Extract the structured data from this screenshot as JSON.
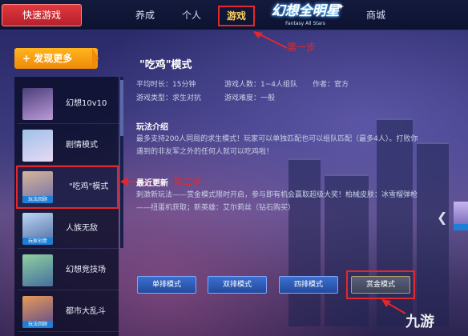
{
  "topbar": {
    "quick_game": "快速游戏",
    "nav": [
      "养成",
      "个人",
      "游戏",
      "商城"
    ],
    "active_nav": "游戏",
    "logo_main": "幻想全明星",
    "logo_sub": "Fantasy All Stars"
  },
  "annotations": {
    "step1": "第一步",
    "step2": "第二步"
  },
  "sidebar": {
    "discover_label": "+ 发现更多",
    "items": [
      {
        "label": "幻想10v10",
        "tag": ""
      },
      {
        "label": "剧情模式",
        "tag": ""
      },
      {
        "label": "\"吃鸡\"模式",
        "tag": "玩法回顾"
      },
      {
        "label": "人族无敌",
        "tag": "玩家创意"
      },
      {
        "label": "幻想竞技场",
        "tag": ""
      },
      {
        "label": "都市大乱斗",
        "tag": "玩法回顾"
      }
    ]
  },
  "panel": {
    "title": "\"吃鸡\"模式",
    "avg_time": "平均时长：15分钟",
    "players": "游戏人数：1~4人组队",
    "author": "作者：官方",
    "type": "游戏类型：求生对抗",
    "difficulty": "游戏难度：一般",
    "rules_head": "玩法介绍",
    "rules_text": [
      "最多支持200人同局的求生模式！玩家可以单独匹配也可以组队匹配（最多4人）。打败你",
      "遇到的非友军之外的任何人就可以吃鸡啦！"
    ],
    "updates_head": "最近更新",
    "updates_text": [
      "刺激新玩法——赏金模式限时开启，参与即有机会赢取超级大奖！柏械皮肤：冰雪榴弹枪",
      "——扭蛋机获取；新英雄：艾尔莉丝（钻石购买）"
    ],
    "buttons": [
      "单排模式",
      "双排模式",
      "四排模式",
      "赏金模式"
    ]
  },
  "watermark": "九游",
  "colors": {
    "accent_red": "#e2282d",
    "discover_orange": "#f5a314",
    "button_blue": "#3b6fcf",
    "bg_dark": "#0c1230"
  }
}
